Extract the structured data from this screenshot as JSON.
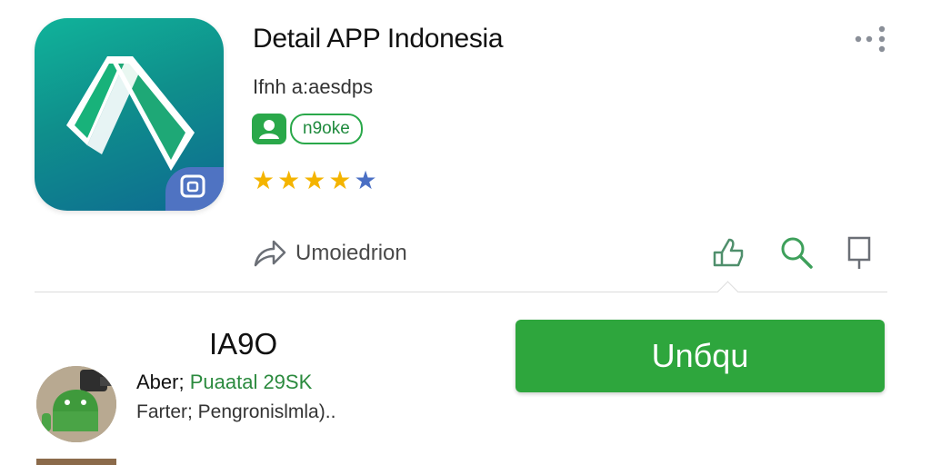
{
  "app": {
    "title": "Detail APP Indonesia",
    "subtitle": "Ifnh a:aesdps",
    "tag_label": "n9oke",
    "rating_stars": 4
  },
  "icons": {
    "app_icon": "app-logo-icon",
    "badge": "badge-icon",
    "tag": "person-icon",
    "menu": "more-menu-icon",
    "share": "share-icon",
    "like": "thumbs-up-icon",
    "search": "search-icon",
    "bookmark": "bookmark-icon"
  },
  "share": {
    "label": "Umoiedrion"
  },
  "download": {
    "size": "IA9O",
    "button_label": "Unбqu"
  },
  "developer": {
    "label": "Aber;",
    "value": "Puaatal 29SK",
    "subline": "Farter; Pengronislmla).."
  },
  "colors": {
    "accent_green": "#2ea63d",
    "star_gold": "#f4b400",
    "star_blue": "#4a6fc4",
    "icon_teal": "#10b39a",
    "icon_blue": "#0d6a91"
  }
}
